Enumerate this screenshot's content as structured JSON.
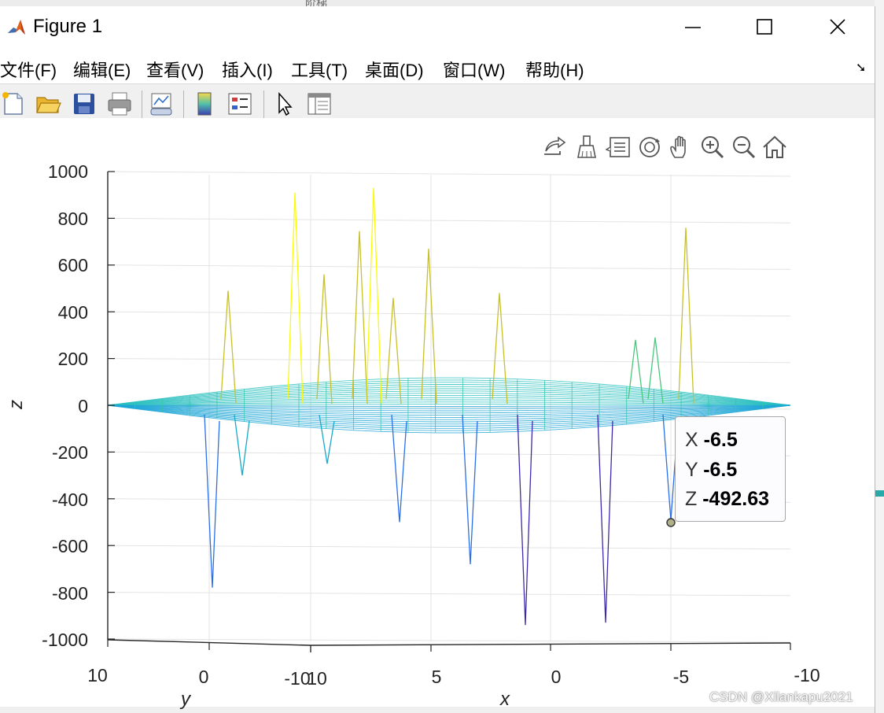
{
  "background_window": {
    "title_fragment": "阶梯"
  },
  "window": {
    "title": "Figure 1"
  },
  "menu": [
    {
      "label": "文件(F)"
    },
    {
      "label": "编辑(E)"
    },
    {
      "label": "查看(V)"
    },
    {
      "label": "插入(I)"
    },
    {
      "label": "工具(T)"
    },
    {
      "label": "桌面(D)"
    },
    {
      "label": "窗口(W)"
    },
    {
      "label": "帮助(H)"
    }
  ],
  "toolbar_icons": [
    "new-figure-icon",
    "open-file-icon",
    "save-figure-icon",
    "print-figure-icon",
    "link-plot-icon",
    "insert-colorbar-icon",
    "insert-legend-icon",
    "edit-plot-arrow-icon",
    "property-inspector-icon"
  ],
  "axes_toolbar_icons": [
    "export-icon",
    "brush-icon",
    "data-tips-icon",
    "rotate-3d-icon",
    "pan-icon",
    "zoom-in-icon",
    "zoom-out-icon",
    "restore-view-icon"
  ],
  "plot": {
    "z_axis_label": "z",
    "y_axis_label": "y",
    "x_axis_label": "x",
    "z_ticks": [
      "1000",
      "800",
      "600",
      "400",
      "200",
      "0",
      "-200",
      "-400",
      "-600",
      "-800",
      "-1000"
    ],
    "y_ticks": [
      "10",
      "0",
      "-10"
    ],
    "x_ticks": [
      "10",
      "5",
      "0",
      "-5",
      "-10"
    ]
  },
  "chart_data": {
    "type": "3d-mesh",
    "zlabel": "z",
    "xlabel": "x",
    "ylabel": "y",
    "zlim": [
      -1000,
      1000
    ],
    "xlim": [
      -10,
      10
    ],
    "ylim": [
      -10,
      10
    ],
    "grid": true,
    "colormap": [
      "#3d2aa8",
      "#2b6fe8",
      "#17a9c9",
      "#4ac77d",
      "#c8c02a",
      "#f9fb0e"
    ],
    "peaks": [
      {
        "z": 910
      },
      {
        "z": 930
      },
      {
        "z": 760
      },
      {
        "z": 745
      },
      {
        "z": 670
      },
      {
        "z": 560
      },
      {
        "z": 490
      },
      {
        "z": 480
      },
      {
        "z": 460
      },
      {
        "z": 280
      },
      {
        "z": 290
      }
    ],
    "troughs": [
      {
        "z": -780
      },
      {
        "z": -940
      },
      {
        "z": -930
      },
      {
        "z": -680
      },
      {
        "z": -500
      },
      {
        "z": -492.63
      },
      {
        "z": -300
      },
      {
        "z": -250
      }
    ]
  },
  "datatip": {
    "x_label": "X",
    "x_value": "-6.5",
    "y_label": "Y",
    "y_value": "-6.5",
    "z_label": "Z",
    "z_value": "-492.63"
  },
  "watermark": "CSDN @Xilankapu2021"
}
